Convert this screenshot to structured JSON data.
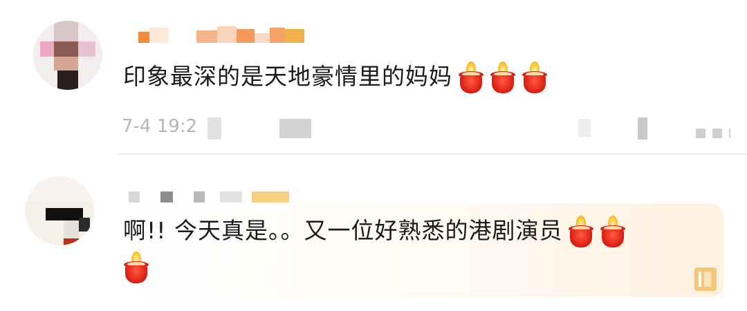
{
  "comments": [
    {
      "text": "印象最深的是天地豪情里的妈妈",
      "timestamp": "7-4 19:2",
      "reactions": [
        "candle-emoji",
        "candle-emoji",
        "candle-emoji"
      ]
    },
    {
      "text_line1": "啊!! 今天真是。。又一位好熟悉的港剧演员",
      "reactions_line1": [
        "candle-emoji",
        "candle-emoji"
      ],
      "reactions_line2": [
        "candle-emoji"
      ]
    }
  ],
  "colors": {
    "text": "#1a1a1a",
    "meta": "#b5b5b5",
    "highlight_bg": "#fff0df",
    "candle_red": "#e02418",
    "flame": "#ffc52c"
  }
}
